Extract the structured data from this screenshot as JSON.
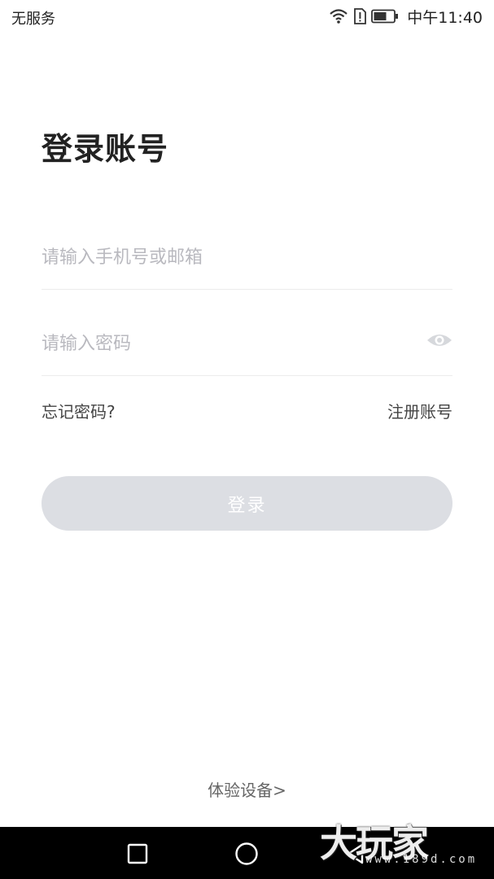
{
  "status_bar": {
    "carrier": "无服务",
    "time": "中午11:40",
    "icons": [
      "wifi-icon",
      "sim-alert-icon",
      "battery-icon"
    ]
  },
  "page": {
    "title": "登录账号"
  },
  "form": {
    "phone_placeholder": "请输入手机号或邮箱",
    "phone_value": "",
    "password_placeholder": "请输入密码",
    "password_value": "",
    "password_toggle_icon": "eye-icon"
  },
  "links": {
    "forgot": "忘记密码?",
    "register": "注册账号"
  },
  "login_button": {
    "label": "登录",
    "state": "disabled",
    "color": "#dcdee3"
  },
  "demo_link": "体验设备>",
  "nav_bar": {
    "icons": [
      "square-recent-icon",
      "circle-home-icon",
      "triangle-back-icon"
    ]
  },
  "watermark": {
    "url": "www.189d.com"
  }
}
